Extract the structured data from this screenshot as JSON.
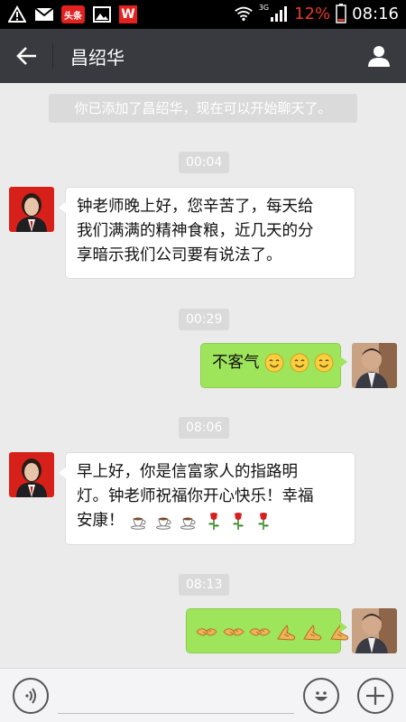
{
  "status_bar": {
    "signal_label": "3G",
    "battery_percent": "12%",
    "time": "08:16",
    "news_app_label": "头条",
    "office_app_label": "W"
  },
  "header": {
    "title": "昌绍华"
  },
  "chat": {
    "system_message": "你已添加了昌绍华，现在可以开始聊天了。",
    "messages": [
      {
        "time": "00:04",
        "direction": "incoming",
        "text_lines": [
          "钟老师晚上好，您辛苦了，每天给",
          "我们满满的精神食粮，近几天的分",
          "享暗示我们公司要有说法了。"
        ]
      },
      {
        "time": "00:29",
        "direction": "outgoing",
        "text": "不客气",
        "emoji": [
          "smile-emoji",
          "smile-emoji",
          "smile-emoji"
        ]
      },
      {
        "time": "08:06",
        "direction": "incoming",
        "text_lines": [
          "早上好，你是信富家人的指路明",
          "灯。钟老师祝福你开心快乐！幸福",
          "安康！"
        ],
        "emoji": [
          "coffee-emoji",
          "coffee-emoji",
          "coffee-emoji",
          "rose-emoji",
          "rose-emoji",
          "rose-emoji"
        ]
      },
      {
        "time": "08:13",
        "direction": "outgoing",
        "text": "",
        "emoji": [
          "handshake-emoji",
          "handshake-emoji",
          "handshake-emoji",
          "fist-salute-emoji",
          "fist-salute-emoji",
          "fist-salute-emoji"
        ]
      }
    ]
  },
  "colors": {
    "title_bar": "#393a3f",
    "chat_background": "#ebebeb",
    "outgoing_bubble": "#9fe55b",
    "incoming_bubble": "#ffffff",
    "battery_low": "#e53a2b"
  }
}
